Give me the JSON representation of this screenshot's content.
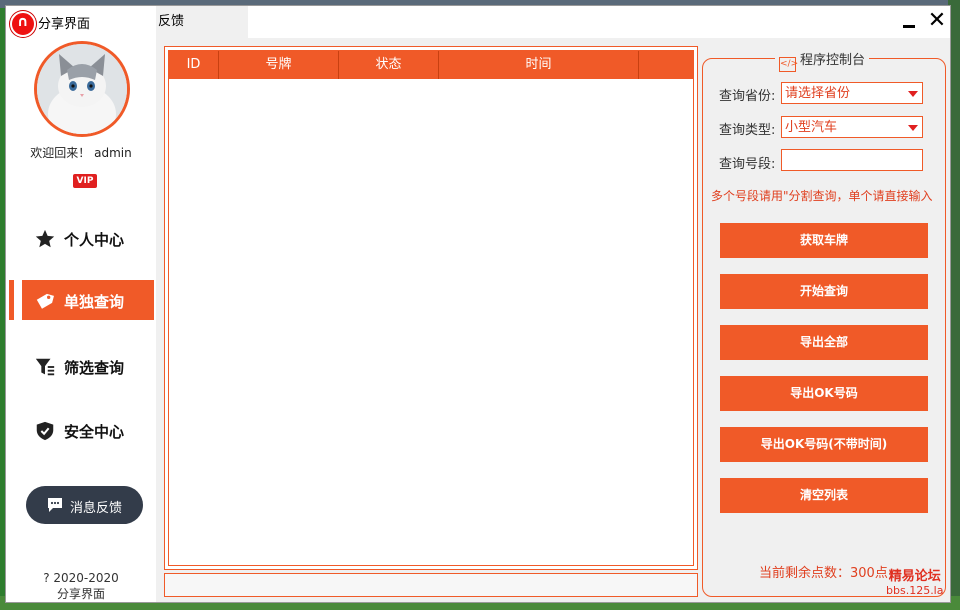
{
  "window": {
    "app_title": "分享界面",
    "tab_label": "反馈"
  },
  "sidebar": {
    "welcome": "欢迎回来！ admin",
    "vip_badge": "VIP",
    "items": [
      {
        "label": "个人中心",
        "icon": "star-icon"
      },
      {
        "label": "单独查询",
        "icon": "tag-icon",
        "active": true
      },
      {
        "label": "筛选查询",
        "icon": "filter-icon"
      },
      {
        "label": "安全中心",
        "icon": "shield-icon"
      }
    ],
    "message_button": "消息反馈",
    "copyright_line1": "? 2020-2020",
    "copyright_line2": "分享界面"
  },
  "table": {
    "columns": [
      "ID",
      "号牌",
      "状态",
      "时间",
      ""
    ],
    "rows": []
  },
  "control_panel": {
    "title": "程序控制台",
    "province_label": "查询省份:",
    "province_value": "请选择省份",
    "type_label": "查询类型:",
    "type_value": "小型汽车",
    "segment_label": "查询号段:",
    "segment_value": "",
    "hint": "多个号段请用\"分割查询，单个请直接输入",
    "buttons": [
      "获取车牌",
      "开始查询",
      "导出全部",
      "导出OK号码",
      "导出OK号码(不带时间)",
      "清空列表"
    ],
    "remaining_points": "当前剩余点数：300点"
  },
  "watermark": {
    "line1": "精易论坛",
    "line2": "bbs.125.la"
  },
  "colors": {
    "accent": "#f05a28",
    "dark_button": "#333c4a"
  }
}
